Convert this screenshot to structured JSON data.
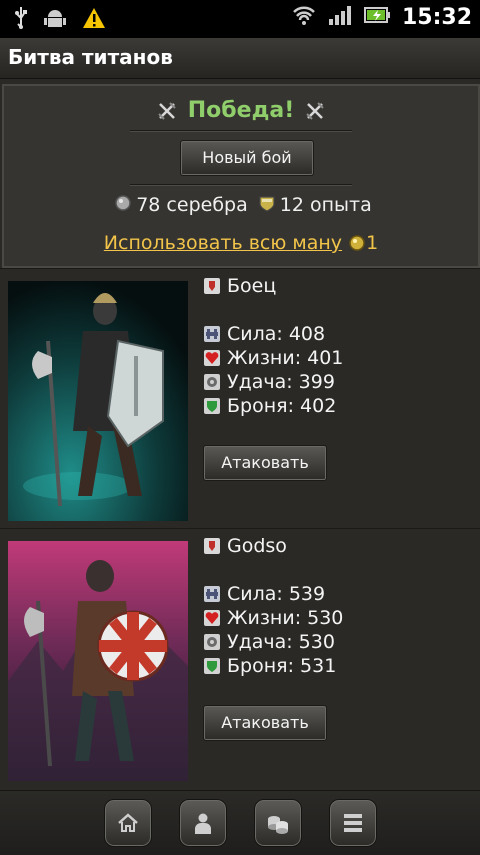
{
  "status_bar": {
    "time": "15:32",
    "icons": [
      "usb-icon",
      "android-debug-icon",
      "warning-icon",
      "wifi-icon",
      "signal-icon",
      "battery-charging-icon"
    ]
  },
  "app": {
    "title": "Битва титанов"
  },
  "result": {
    "title": "Победа!",
    "new_battle_label": "Новый бой",
    "silver_text": "78 серебра",
    "exp_text": "12 опыта",
    "use_mana_label": "Использовать всю ману",
    "mana_cost": "1"
  },
  "fighters": [
    {
      "name": "Боец",
      "stats": [
        {
          "label": "Сила: 408",
          "icon": "strength-icon"
        },
        {
          "label": "Жизни: 401",
          "icon": "health-icon"
        },
        {
          "label": "Удача: 399",
          "icon": "luck-icon"
        },
        {
          "label": "Броня: 402",
          "icon": "armor-icon"
        }
      ],
      "attack_label": "Атаковать"
    },
    {
      "name": "Godso",
      "stats": [
        {
          "label": "Сила: 539",
          "icon": "strength-icon"
        },
        {
          "label": "Жизни: 530",
          "icon": "health-icon"
        },
        {
          "label": "Удача: 530",
          "icon": "luck-icon"
        },
        {
          "label": "Броня: 531",
          "icon": "armor-icon"
        }
      ],
      "attack_label": "Атаковать"
    }
  ],
  "nav": {
    "items": [
      "home-icon",
      "profile-icon",
      "coins-icon",
      "menu-icon"
    ]
  },
  "colors": {
    "victory": "#8fce6b",
    "mana_link": "#f2c44a",
    "background": "#2a2926"
  }
}
